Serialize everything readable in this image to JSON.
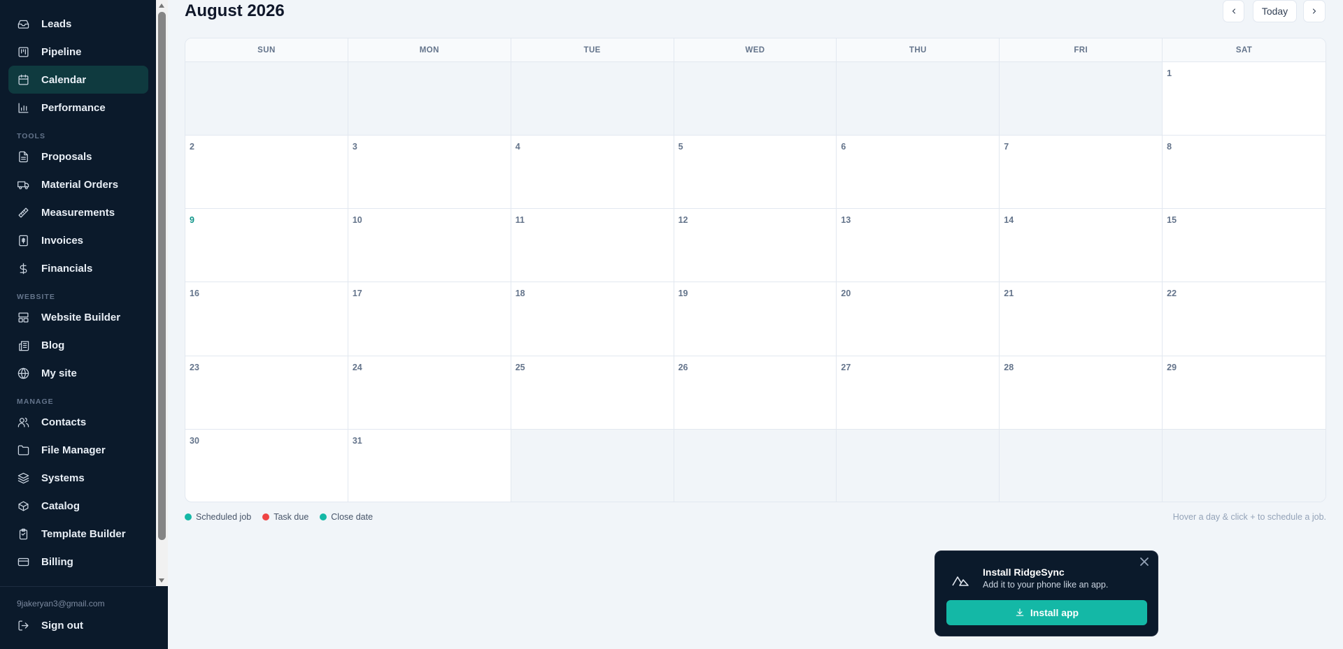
{
  "sidebar": {
    "items": [
      {
        "label": "Leads",
        "icon": "inbox-icon"
      },
      {
        "label": "Pipeline",
        "icon": "kanban-icon"
      },
      {
        "label": "Calendar",
        "icon": "calendar-icon",
        "active": true
      },
      {
        "label": "Performance",
        "icon": "bar-chart-icon"
      }
    ],
    "tools_label": "TOOLS",
    "tools": [
      {
        "label": "Proposals",
        "icon": "document-icon"
      },
      {
        "label": "Material Orders",
        "icon": "truck-icon"
      },
      {
        "label": "Measurements",
        "icon": "ruler-icon"
      },
      {
        "label": "Invoices",
        "icon": "receipt-icon"
      },
      {
        "label": "Financials",
        "icon": "dollar-icon"
      }
    ],
    "website_label": "WEBSITE",
    "website": [
      {
        "label": "Website Builder",
        "icon": "layout-icon"
      },
      {
        "label": "Blog",
        "icon": "newspaper-icon"
      },
      {
        "label": "My site",
        "icon": "globe-icon"
      }
    ],
    "manage_label": "MANAGE",
    "manage": [
      {
        "label": "Contacts",
        "icon": "users-icon"
      },
      {
        "label": "File Manager",
        "icon": "folder-icon"
      },
      {
        "label": "Systems",
        "icon": "layers-icon"
      },
      {
        "label": "Catalog",
        "icon": "package-icon"
      },
      {
        "label": "Template Builder",
        "icon": "clipboard-icon"
      },
      {
        "label": "Billing",
        "icon": "credit-card-icon"
      }
    ],
    "email": "9jakeryan3@gmail.com",
    "sign_out": "Sign out"
  },
  "header": {
    "title": "August 2026",
    "today_label": "Today",
    "prev_icon": "chevron-left-icon",
    "next_icon": "chevron-right-icon"
  },
  "calendar": {
    "weekdays": [
      "SUN",
      "MON",
      "TUE",
      "WED",
      "THU",
      "FRI",
      "SAT"
    ],
    "first_weekday_index": 6,
    "days_in_month": 31,
    "today": 9
  },
  "legend": [
    {
      "label": "Scheduled job",
      "color": "#14b8a6"
    },
    {
      "label": "Task due",
      "color": "#ef4444"
    },
    {
      "label": "Close date",
      "color": "#14b8a6"
    }
  ],
  "hint": "Hover a day & click + to schedule a job.",
  "install": {
    "title": "Install RidgeSync",
    "subtitle": "Add it to your phone like an app.",
    "button": "Install app"
  }
}
